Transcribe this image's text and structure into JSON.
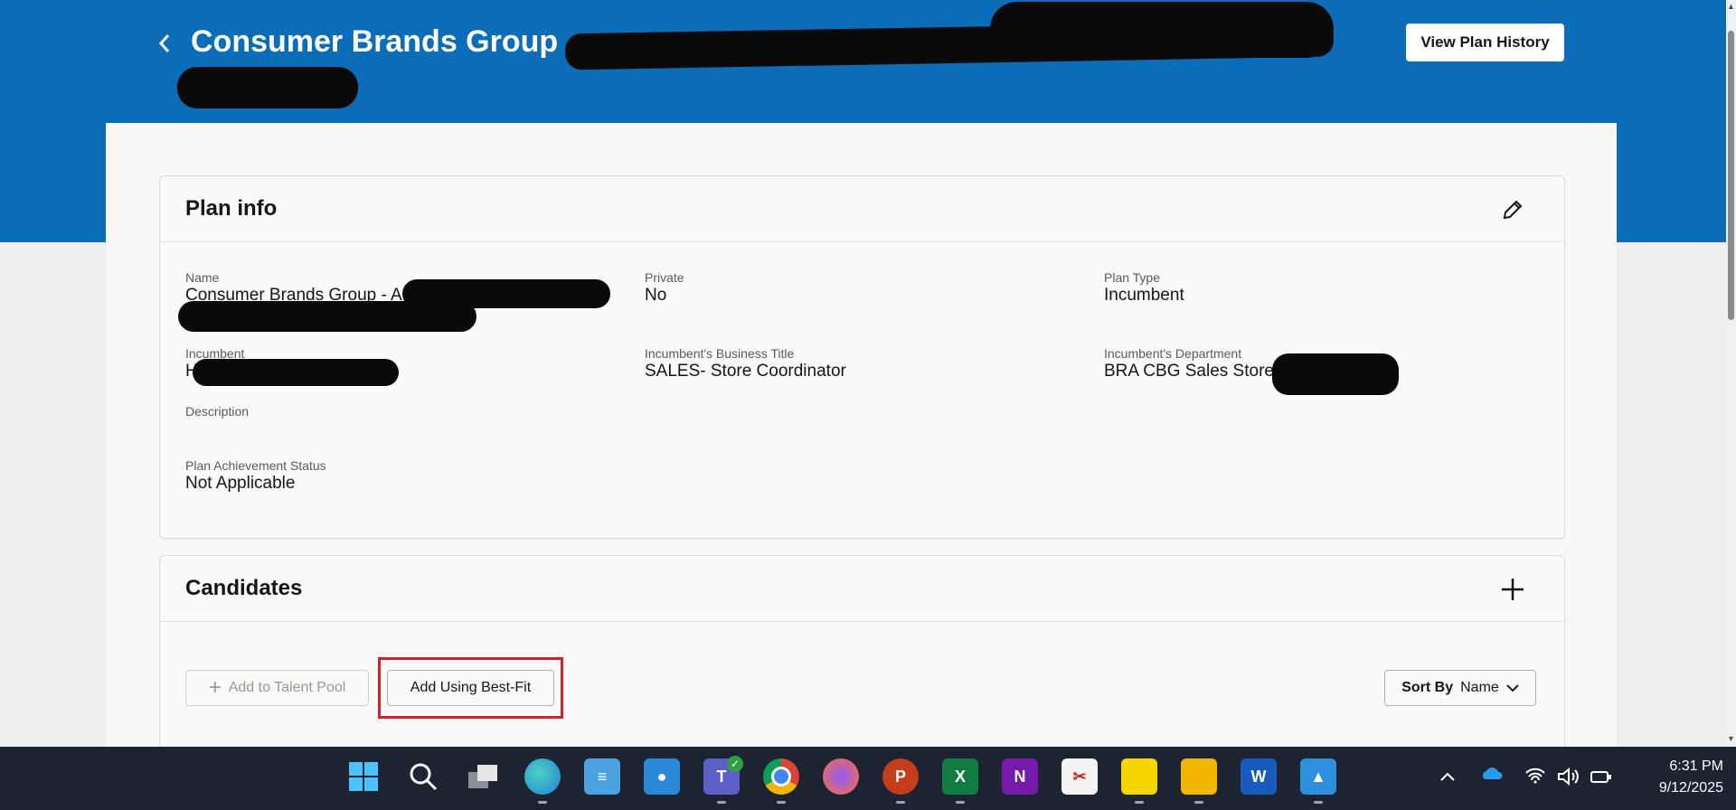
{
  "header": {
    "title": "Consumer Brands Group - ",
    "view_history_label": "View Plan History"
  },
  "plan_info": {
    "title": "Plan info",
    "fields": {
      "name": {
        "label": "Name",
        "value": "Consumer Brands Group - A"
      },
      "private": {
        "label": "Private",
        "value": "No"
      },
      "plan_type": {
        "label": "Plan Type",
        "value": "Incumbent"
      },
      "incumbent": {
        "label": "Incumbent",
        "value": "H"
      },
      "business_title": {
        "label": "Incumbent's Business Title",
        "value": "SALES- Store Coordinator"
      },
      "department": {
        "label": "Incumbent's Department",
        "value": "BRA CBG Sales Store "
      },
      "description": {
        "label": "Description",
        "value": ""
      },
      "achievement": {
        "label": "Plan Achievement Status",
        "value": "Not Applicable"
      }
    }
  },
  "candidates": {
    "title": "Candidates",
    "add_to_pool_label": "Add to Talent Pool",
    "add_best_fit_label": "Add Using Best-Fit",
    "sort": {
      "prefix": "Sort By",
      "value": "Name"
    }
  },
  "taskbar": {
    "apps": [
      "start-icon",
      "search-icon",
      "task-view-icon",
      "edge-icon",
      "notepad-icon",
      "contacts-icon",
      "teams-icon",
      "chrome-icon",
      "firefox-icon",
      "powerpoint-icon",
      "excel-icon",
      "onenote-icon",
      "snipping-tool-icon",
      "sticky-notes-icon",
      "file-explorer-icon",
      "word-icon",
      "photos-icon"
    ],
    "time": "6:31 PM",
    "date": "9/12/2025"
  },
  "colors": {
    "banner": "#0b6cb8",
    "highlight": "#d4202a",
    "taskbar": "#1c2331"
  }
}
